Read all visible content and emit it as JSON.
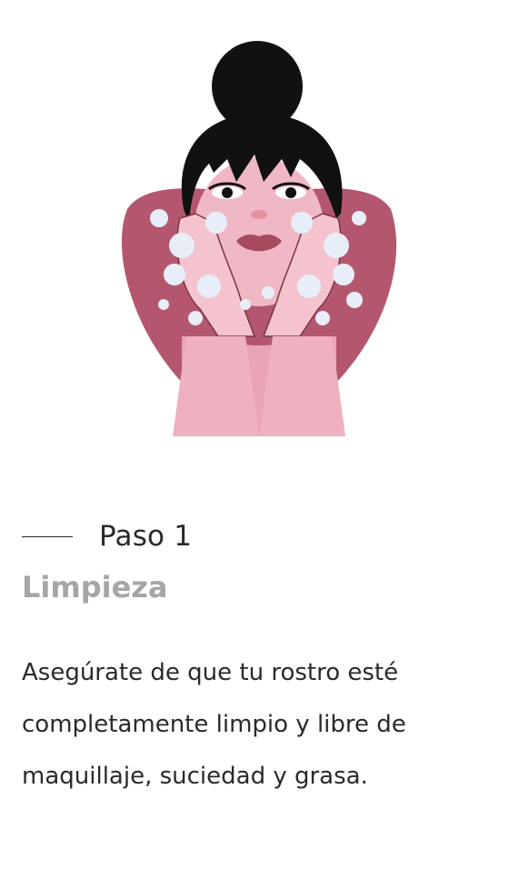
{
  "step": {
    "label": "Paso 1",
    "title": "Limpieza",
    "description": "Asegúrate de que tu rostro esté completamente limpio y libre de maquillaje, suciedad y grasa."
  },
  "illustration": {
    "icon": "face-washing-illustration",
    "colors": {
      "background_shape": "#b4576e",
      "skin": "#f0b8c4",
      "hair": "#111111",
      "foam": "#e8eef8"
    }
  }
}
